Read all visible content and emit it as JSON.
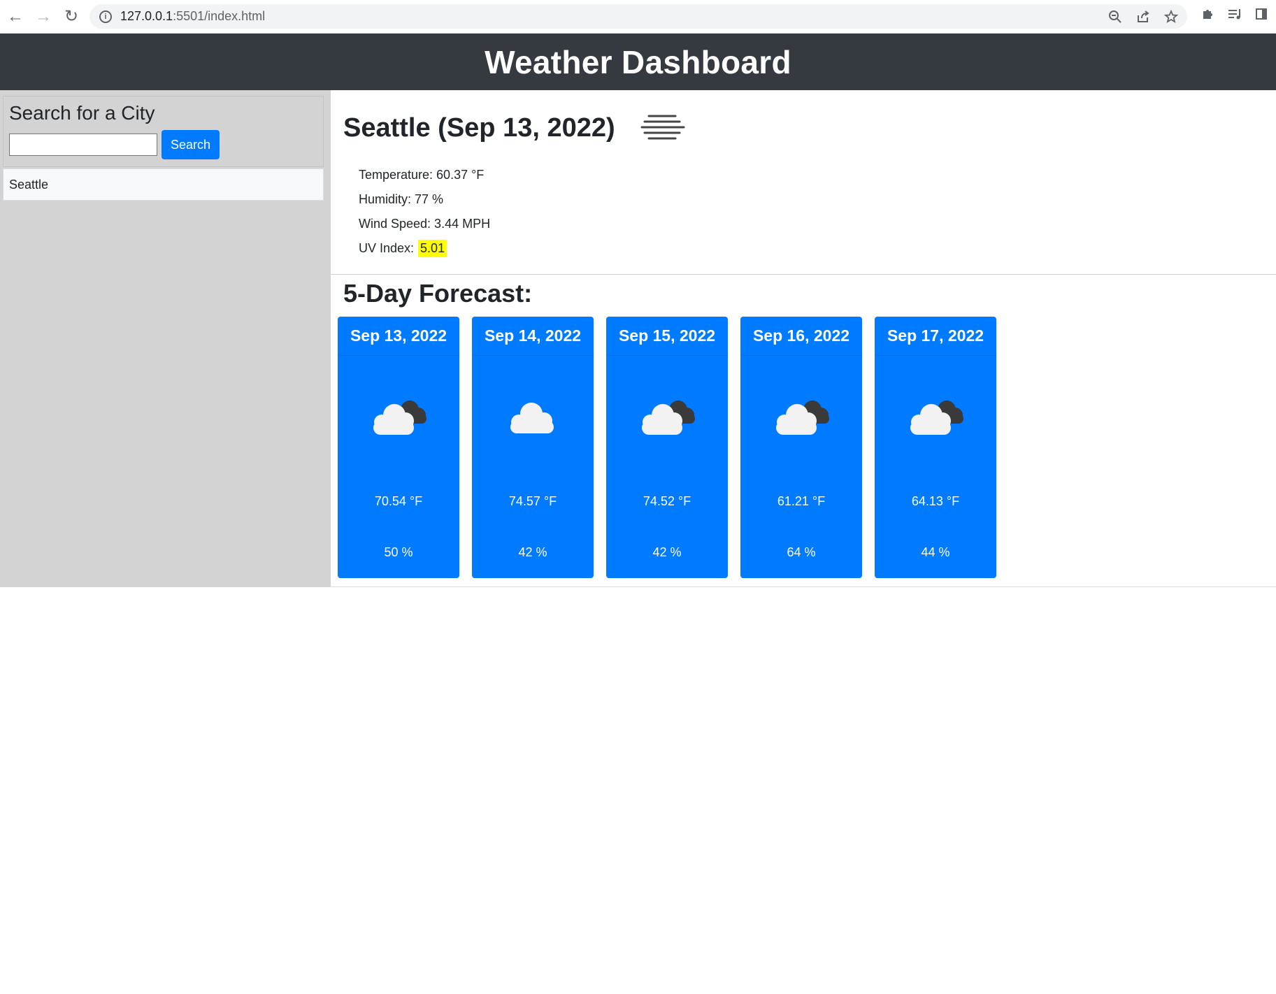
{
  "browser": {
    "url_host": "127.0.0.1",
    "url_rest": ":5501/index.html"
  },
  "header": {
    "title": "Weather Dashboard"
  },
  "sidebar": {
    "search_title": "Search for a City",
    "search_value": "",
    "search_button": "Search",
    "history": [
      "Seattle"
    ]
  },
  "current": {
    "heading": "Seattle (Sep 13, 2022)",
    "icon": "mist-icon",
    "temperature": "Temperature: 60.37 °F",
    "humidity": "Humidity: 77 %",
    "wind": "Wind Speed: 3.44 MPH",
    "uv_label": "UV Index:",
    "uv_value": "5.01",
    "uv_color": "#ffff00"
  },
  "forecast": {
    "title": "5-Day Forecast:",
    "card_color": "#007bff",
    "days": [
      {
        "date": "Sep 13, 2022",
        "icon": "broken-clouds-icon",
        "temp": "70.54 °F",
        "humidity": "50 %"
      },
      {
        "date": "Sep 14, 2022",
        "icon": "scattered-clouds-icon",
        "temp": "74.57 °F",
        "humidity": "42 %"
      },
      {
        "date": "Sep 15, 2022",
        "icon": "broken-clouds-icon",
        "temp": "74.52 °F",
        "humidity": "42 %"
      },
      {
        "date": "Sep 16, 2022",
        "icon": "broken-clouds-icon",
        "temp": "61.21 °F",
        "humidity": "64 %"
      },
      {
        "date": "Sep 17, 2022",
        "icon": "broken-clouds-icon",
        "temp": "64.13 °F",
        "humidity": "44 %"
      }
    ]
  }
}
